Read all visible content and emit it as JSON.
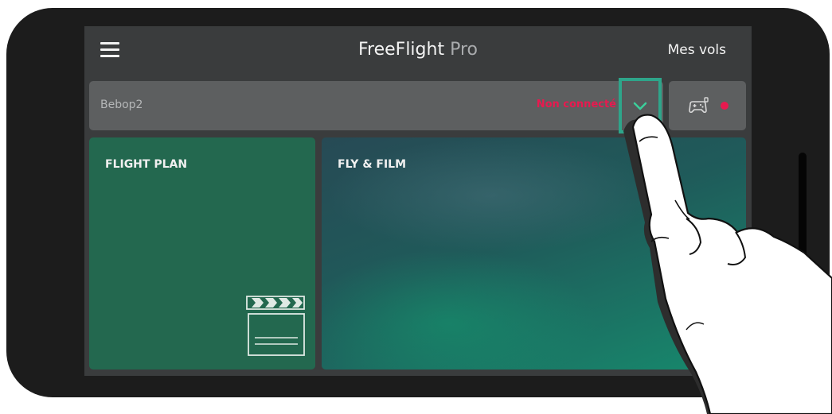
{
  "header": {
    "menu_icon": "hamburger-menu-icon",
    "title_main": "FreeFlight",
    "title_suffix": "Pro",
    "my_flights": "Mes vols"
  },
  "drone": {
    "name": "Bebop2",
    "status": "Non connecté",
    "status_color": "#e8194f",
    "dropdown_icon": "chevron-down-icon",
    "highlight_color": "#2ea58a"
  },
  "controller": {
    "icon": "gamepad-icon",
    "status_dot_color": "#e8194f"
  },
  "tiles": [
    {
      "label": "FLIGHT PLAN",
      "icon": "clapperboard-icon",
      "color": "#23684f"
    },
    {
      "label": "FLY & FILM"
    }
  ]
}
